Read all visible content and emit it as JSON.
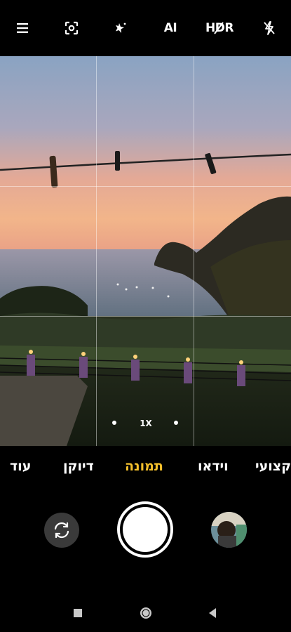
{
  "toolbar": {
    "items": [
      {
        "name": "menu-icon"
      },
      {
        "name": "focus-icon"
      },
      {
        "name": "beauty-icon"
      },
      {
        "name": "ai-toggle",
        "label": "AI"
      },
      {
        "name": "hdr-toggle",
        "label": "HDR"
      },
      {
        "name": "flash-off-icon"
      }
    ]
  },
  "viewfinder": {
    "zoom_label": "1X",
    "grid": "3x3"
  },
  "modes": {
    "items": [
      {
        "label": "עוד",
        "active": false
      },
      {
        "label": "דיוקן",
        "active": false
      },
      {
        "label": "תמונה",
        "active": true
      },
      {
        "label": "וידאו",
        "active": false
      },
      {
        "label": "מקצועי",
        "active": false
      }
    ]
  },
  "controls": {
    "flip_camera": "flip-camera-icon",
    "shutter": "shutter-button",
    "gallery": "gallery-thumbnail"
  },
  "navbar": {
    "items": [
      "recents-icon",
      "home-icon",
      "back-icon"
    ]
  },
  "colors": {
    "active_mode": "#f4c02c",
    "background": "#000000"
  }
}
